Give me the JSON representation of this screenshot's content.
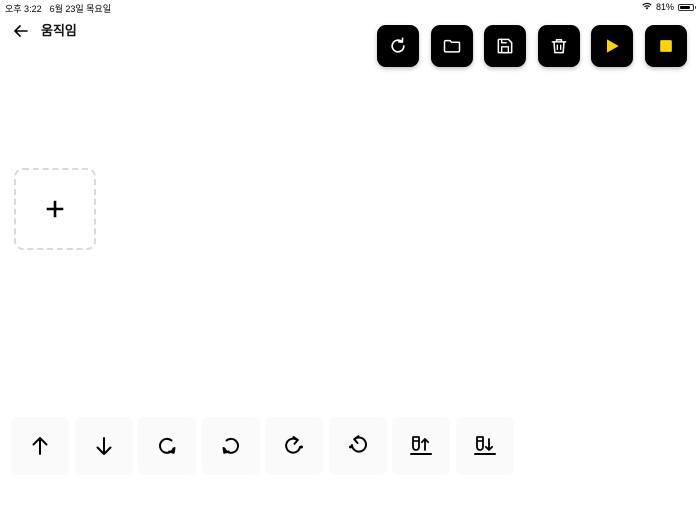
{
  "status_bar": {
    "time": "오후 3:22",
    "date": "6월 23일 목요일",
    "battery": "81%",
    "battery_level": 0.81
  },
  "header": {
    "back_icon": "arrow-left-icon",
    "title": "움직임"
  },
  "toolbar": {
    "buttons": [
      {
        "name": "refresh",
        "icon": "refresh-icon"
      },
      {
        "name": "open",
        "icon": "folder-icon"
      },
      {
        "name": "save",
        "icon": "save-icon"
      },
      {
        "name": "delete",
        "icon": "trash-icon"
      },
      {
        "name": "play",
        "icon": "play-icon"
      },
      {
        "name": "stop",
        "icon": "stop-icon"
      }
    ]
  },
  "sequence": {
    "add_icon": "plus-icon"
  },
  "palette": {
    "commands": [
      {
        "name": "move-forward",
        "icon": "arrow-up-icon"
      },
      {
        "name": "move-backward",
        "icon": "arrow-down-icon"
      },
      {
        "name": "turn-right",
        "icon": "rotate-clockwise-icon"
      },
      {
        "name": "turn-left",
        "icon": "rotate-counterclockwise-icon"
      },
      {
        "name": "rotate-right-step",
        "icon": "redo-dot-icon"
      },
      {
        "name": "rotate-left-step",
        "icon": "undo-dot-icon"
      },
      {
        "name": "pen-up",
        "icon": "pen-up-icon"
      },
      {
        "name": "pen-down",
        "icon": "pen-down-icon"
      }
    ]
  },
  "colors": {
    "accent": "#FFD400",
    "button_bg": "#000000",
    "tile_bg": "#FAFAFA",
    "dashed_border": "#D9D9D9"
  }
}
